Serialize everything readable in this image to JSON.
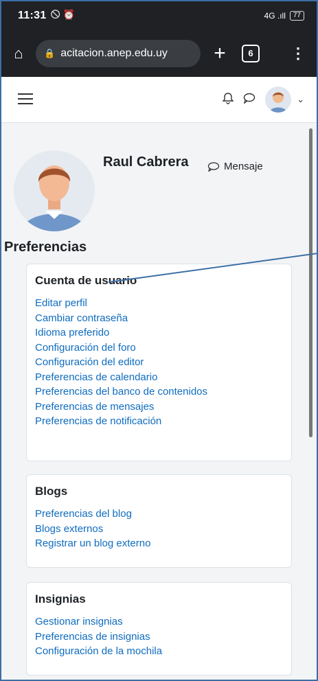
{
  "status_bar": {
    "time": "11:31",
    "left_icons": "🛇 ⏰",
    "signal": "4G .ıll",
    "battery": "77"
  },
  "browser": {
    "url": "acitacion.anep.edu.uy",
    "tab_count": "6"
  },
  "navbar": {
    "menu_icon": "hamburger-icon",
    "bell_icon": "bell-icon",
    "chat_icon": "chat-icon"
  },
  "profile": {
    "name": "Raul Cabrera",
    "message_label": "Mensaje"
  },
  "preferences_title": "Preferencias",
  "cards": [
    {
      "title": "Cuenta de usuario",
      "links": [
        "Editar perfil",
        "Cambiar contraseña",
        "Idioma preferido",
        "Configuración del foro",
        "Configuración del editor",
        "Preferencias de calendario",
        "Preferencias del banco de contenidos",
        "Preferencias de mensajes",
        "Preferencias de notificación"
      ]
    },
    {
      "title": "Blogs",
      "links": [
        "Preferencias del blog",
        "Blogs externos",
        "Registrar un blog externo"
      ]
    },
    {
      "title": "Insignias",
      "links": [
        "Gestionar insignias",
        "Preferencias de insignias",
        "Configuración de la mochila"
      ]
    }
  ],
  "colors": {
    "link": "#0f6cbf",
    "chrome": "#1f2124",
    "page_bg": "#f3f4f6",
    "frame_border": "#3b6fa6"
  }
}
